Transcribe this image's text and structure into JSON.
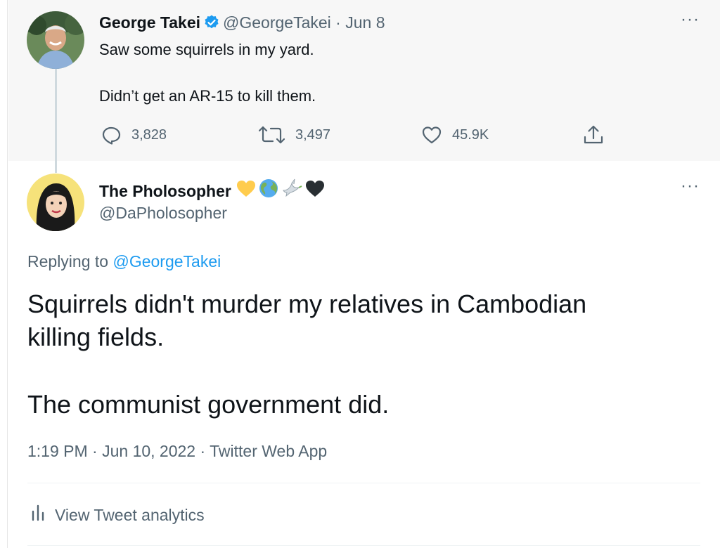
{
  "parent_tweet": {
    "author_name": "George Takei",
    "handle_date": "@GeorgeTakei · Jun 8",
    "line1": "Saw some squirrels in my yard.",
    "line2": "Didn’t get an AR-15 to kill them.",
    "replies": "3,828",
    "retweets": "3,497",
    "likes": "45.9K"
  },
  "reply_tweet": {
    "author_name": "The Pholosopher",
    "handle": "@DaPholosopher",
    "replying_prefix": "Replying to",
    "replying_to": "@GeorgeTakei",
    "text_line1": "Squirrels didn't murder my relatives in Cambodian",
    "text_line2": "killing fields.",
    "text_line3": "The communist government did.",
    "timestamp": "1:19 PM · Jun 10, 2022 · Twitter Web App",
    "analytics_label": "View Tweet analytics"
  },
  "more_glyph": "···",
  "icons": {
    "verified": "verified-badge-icon",
    "reply": "reply-icon",
    "retweet": "retweet-icon",
    "like": "heart-icon",
    "share": "share-icon",
    "analytics": "bar-chart-icon",
    "emojis": [
      "yellow-heart-icon",
      "globe-icon",
      "dove-icon",
      "black-heart-icon"
    ]
  },
  "colors": {
    "accent": "#1d9bf0",
    "text": "#0f1419",
    "muted": "#536471",
    "parent_bg": "#f7f7f7"
  }
}
